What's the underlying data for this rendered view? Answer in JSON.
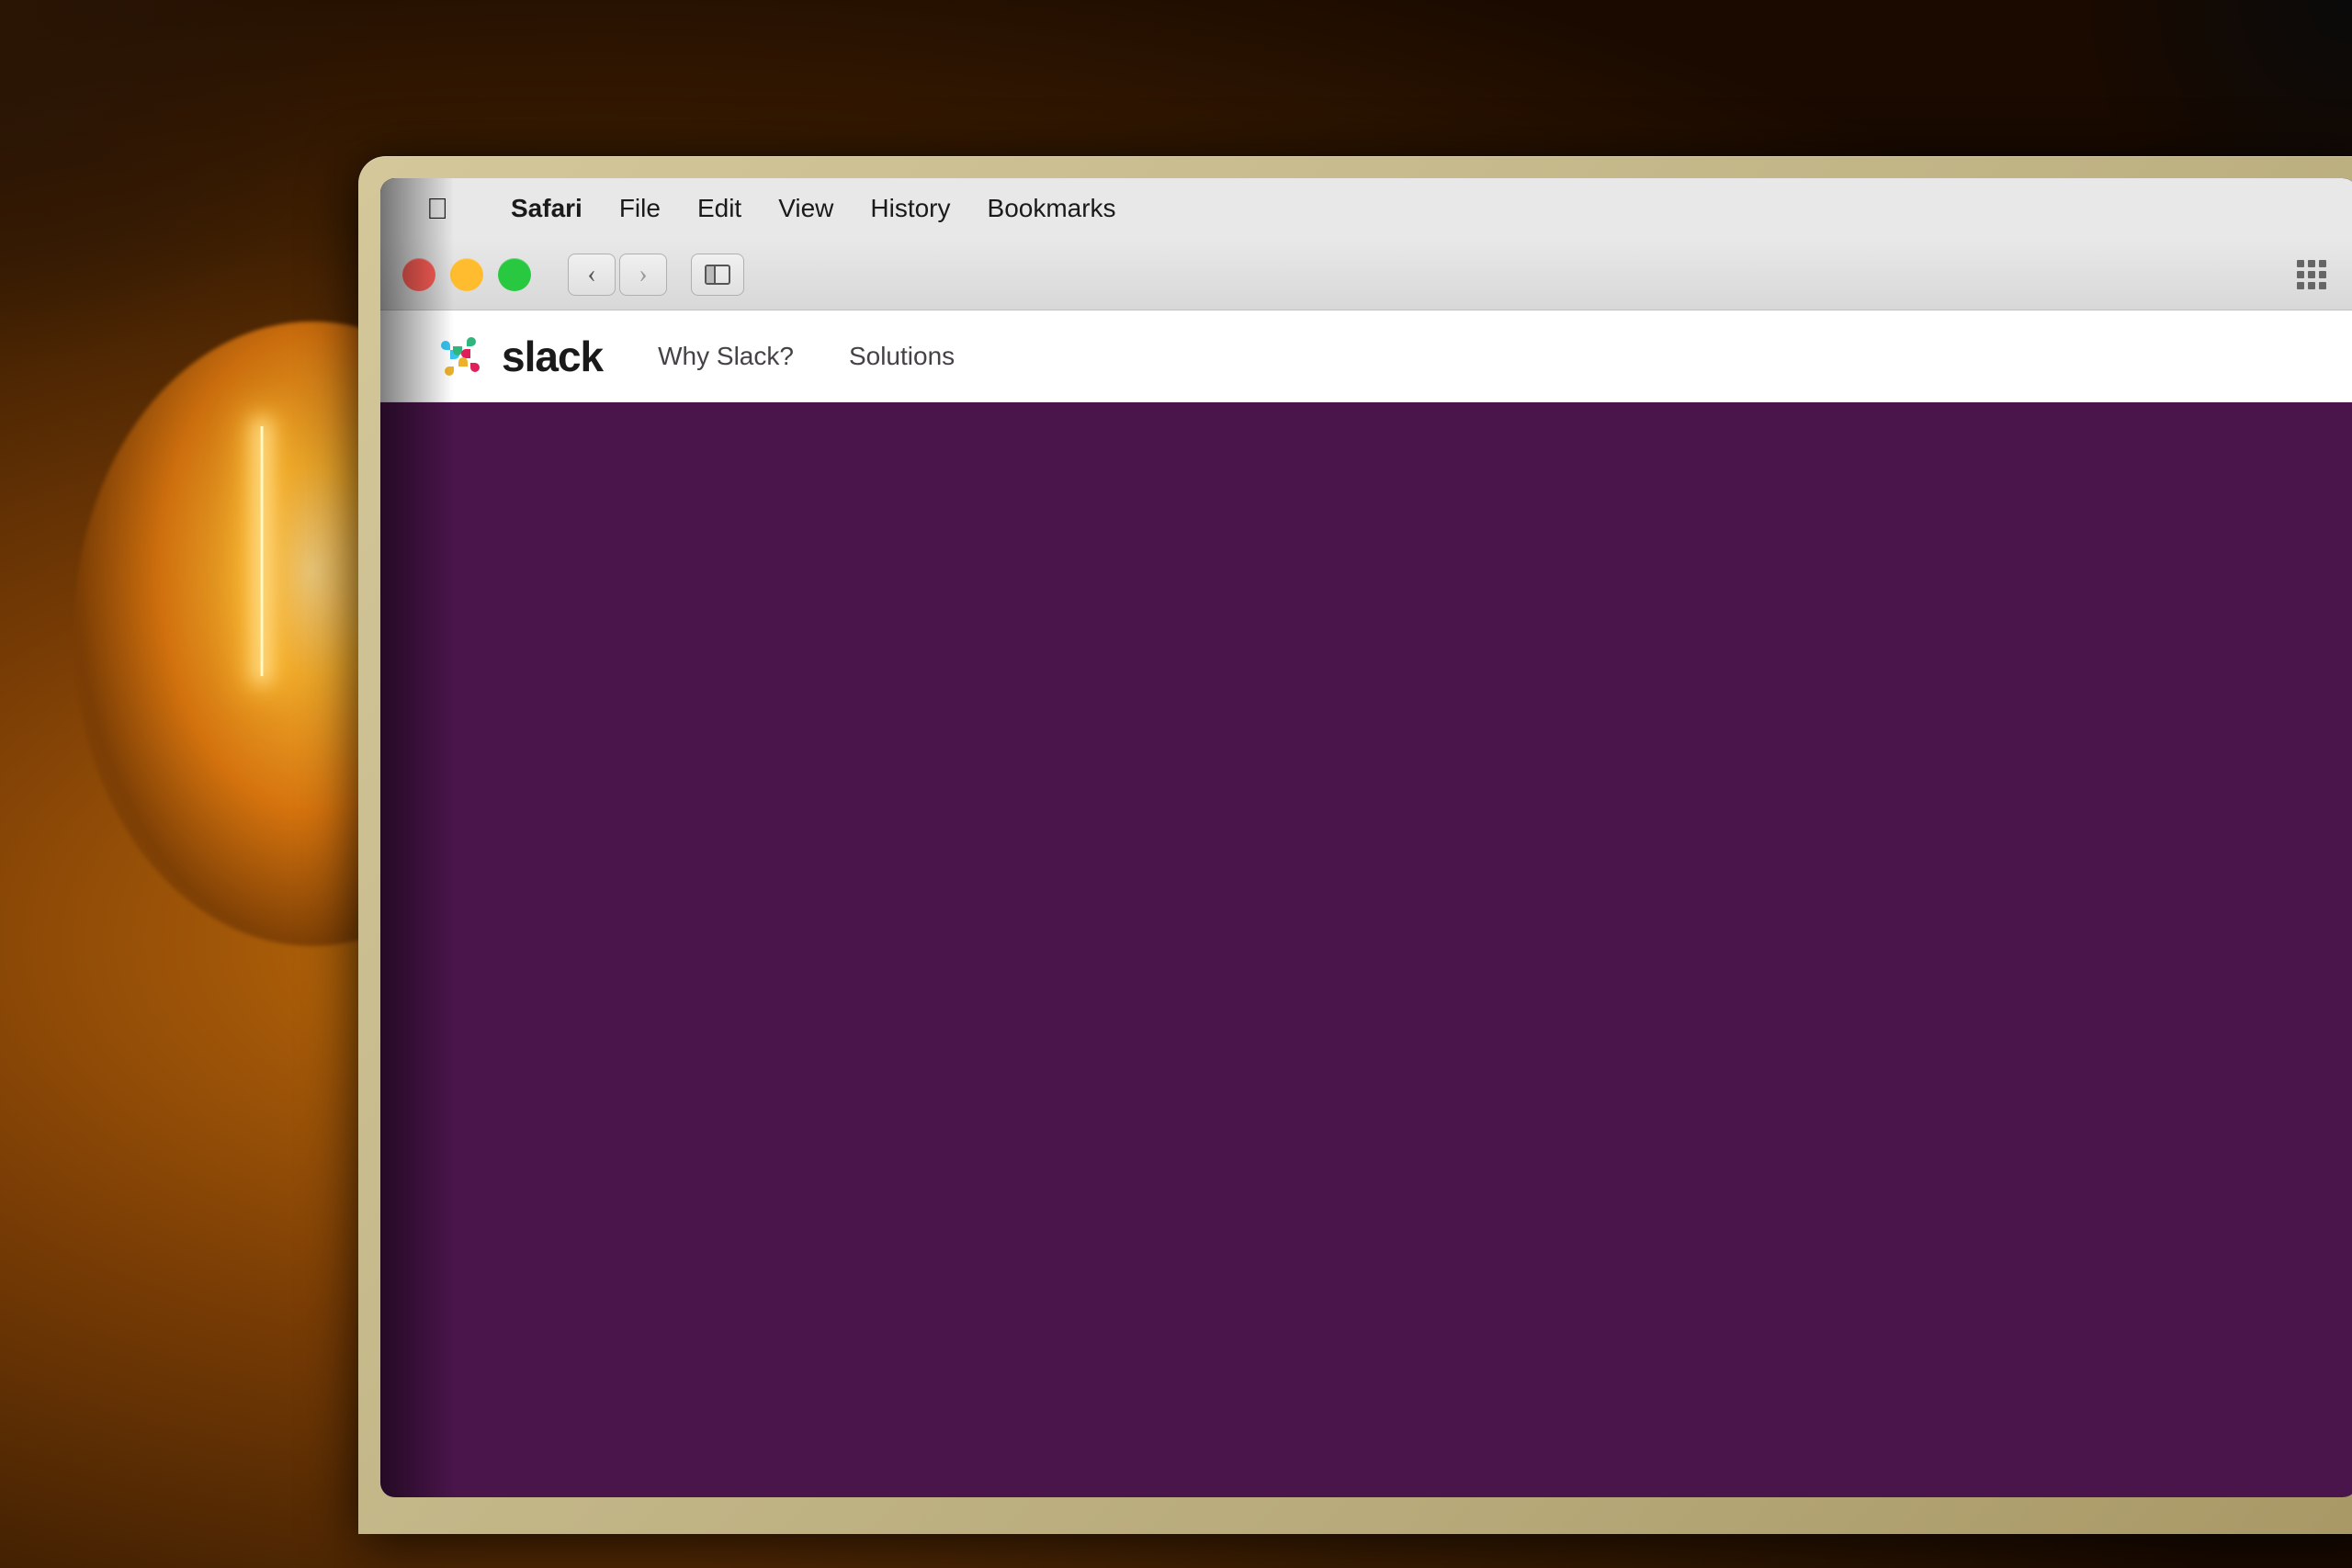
{
  "background": {
    "color": "#1a0a00"
  },
  "menubar": {
    "apple_label": "",
    "items": [
      {
        "label": "Safari",
        "bold": true
      },
      {
        "label": "File",
        "bold": false
      },
      {
        "label": "Edit",
        "bold": false
      },
      {
        "label": "View",
        "bold": false
      },
      {
        "label": "History",
        "bold": false
      },
      {
        "label": "Bookmarks",
        "bold": false
      }
    ]
  },
  "browser": {
    "traffic_lights": {
      "close_color": "#ff5f57",
      "minimize_color": "#febc2e",
      "maximize_color": "#28c840"
    },
    "nav_back_label": "‹",
    "nav_forward_label": "›"
  },
  "slack": {
    "logo_wordmark": "slack",
    "nav_items": [
      {
        "label": "Why Slack?"
      },
      {
        "label": "Solutions"
      }
    ],
    "hero_color": "#4a154b"
  }
}
